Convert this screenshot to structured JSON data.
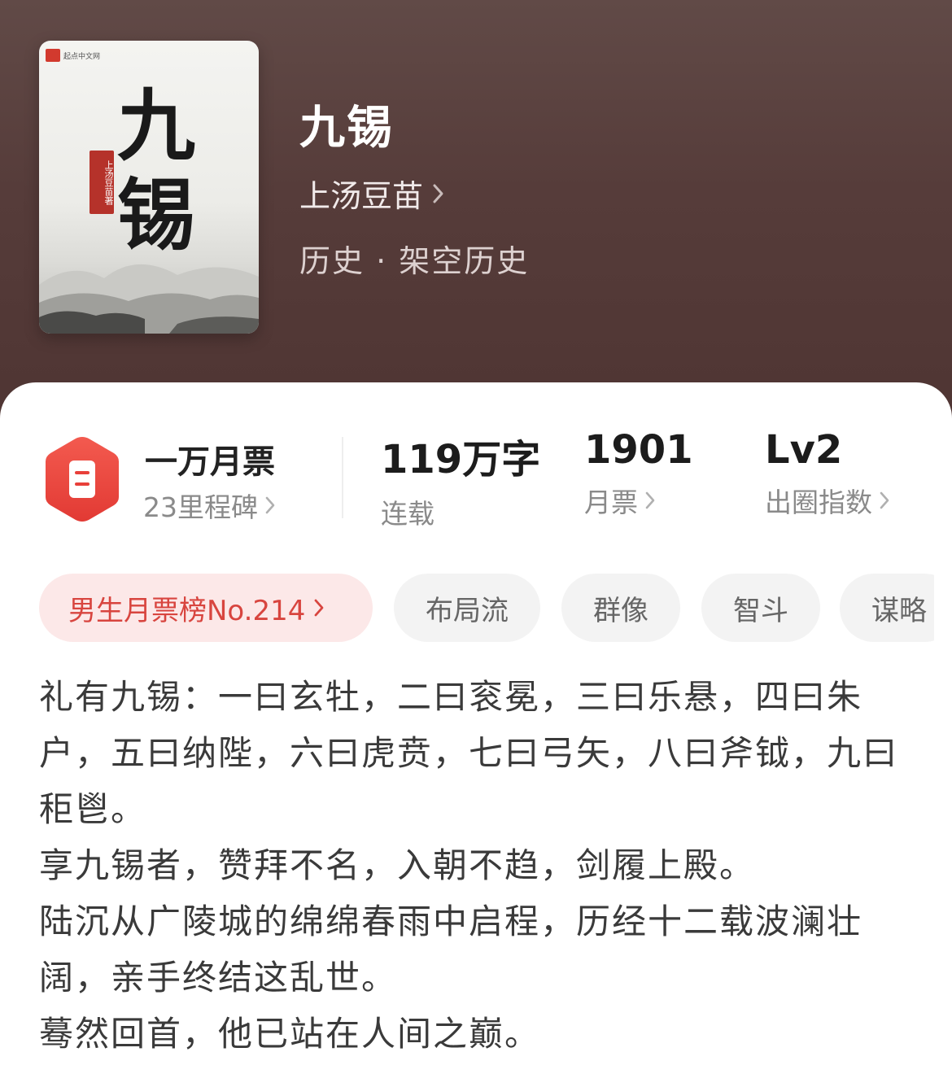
{
  "book": {
    "cover": {
      "publisher": "起点中文网",
      "title_art": "九锡",
      "author_seal": "上汤豆苗著"
    },
    "title": "九锡",
    "author": "上汤豆苗",
    "category": "历史 · 架空历史"
  },
  "stats": {
    "monthly_ticket": {
      "title": "一万月票",
      "milestones": "23里程碑",
      "icon": "ticket-icon"
    },
    "word_count": {
      "value": "119万字",
      "label": "连载"
    },
    "votes": {
      "value": "1901",
      "label": "月票"
    },
    "level": {
      "value": "Lv2",
      "label": "出圈指数"
    }
  },
  "tags": {
    "rank": "男生月票榜No.214",
    "items": [
      "布局流",
      "群像",
      "智斗",
      "谋略"
    ]
  },
  "description": {
    "paragraphs": [
      "礼有九锡：一曰玄牡，二曰衮冕，三曰乐悬，四曰朱户，五曰纳陛，六曰虎贲，七曰弓矢，八曰斧钺，九曰秬鬯。",
      "享九锡者，赞拜不名，入朝不趋，剑履上殿。",
      "陆沉从广陵城的绵绵春雨中启程，历经十二载波澜壮阔，亲手终结这乱世。",
      "蓦然回首，他已站在人间之巅。"
    ]
  },
  "colors": {
    "header_bg": "#563c3a",
    "accent_red": "#e8403a",
    "rank_tag_bg": "#fce8e8",
    "rank_tag_text": "#d8453f"
  }
}
